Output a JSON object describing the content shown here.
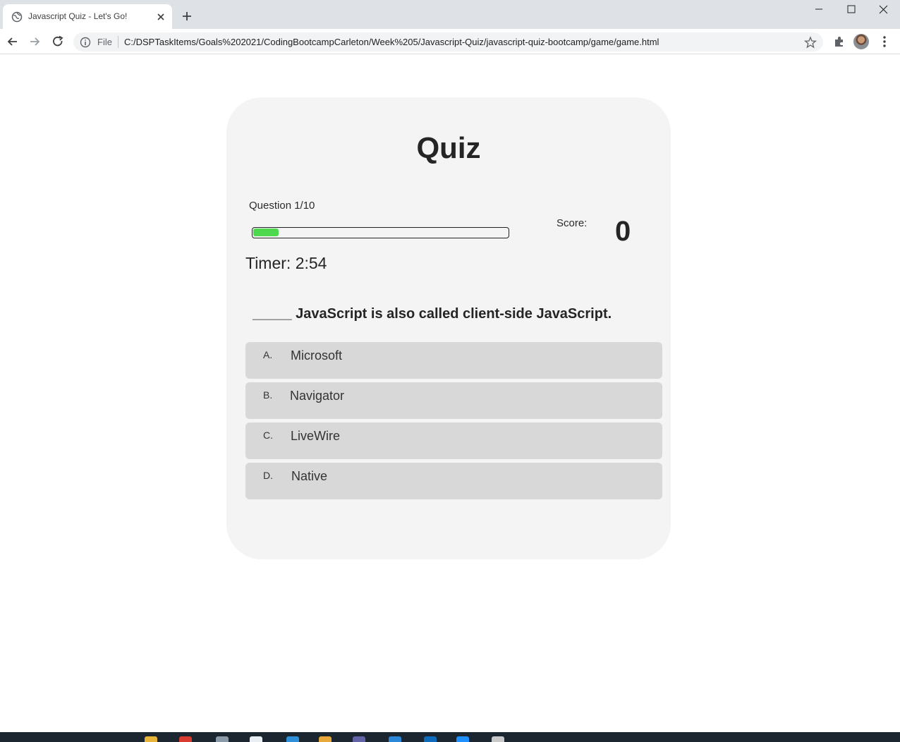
{
  "browser": {
    "tab_title": "Javascript Quiz - Let's Go!",
    "address_scheme_label": "File",
    "url": "C:/DSPTaskItems/Goals%202021/CodingBootcampCarleton/Week%205/Javascript-Quiz/javascript-quiz-bootcamp/game/game.html"
  },
  "quiz": {
    "title": "Quiz",
    "question_counter": "Question 1/10",
    "progress_fraction": 0.1,
    "score_label": "Score:",
    "score_value": "0",
    "timer": "Timer: 2:54",
    "question": "_____ JavaScript is also called client-side JavaScript.",
    "choices": [
      {
        "prefix": "A.",
        "text": "Microsoft"
      },
      {
        "prefix": "B.",
        "text": "Navigator"
      },
      {
        "prefix": "C.",
        "text": "LiveWire"
      },
      {
        "prefix": "D.",
        "text": "Native"
      }
    ]
  },
  "colors": {
    "progress_fill": "#4dd84d",
    "card_bg": "#f4f4f4",
    "choice_bg": "#d9d8d9"
  }
}
